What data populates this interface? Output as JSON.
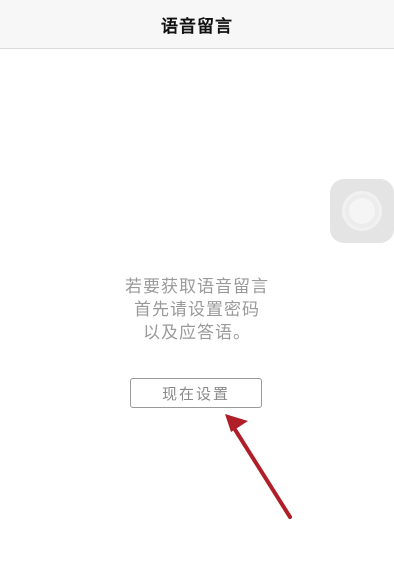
{
  "nav": {
    "title": "语音留言"
  },
  "message": {
    "lines": [
      "若要获取语音留言",
      "首先请设置密码",
      "以及应答语。"
    ]
  },
  "setup_button": {
    "label": "现在设置"
  },
  "annotation": {
    "arrow_color": "#b01e28"
  }
}
